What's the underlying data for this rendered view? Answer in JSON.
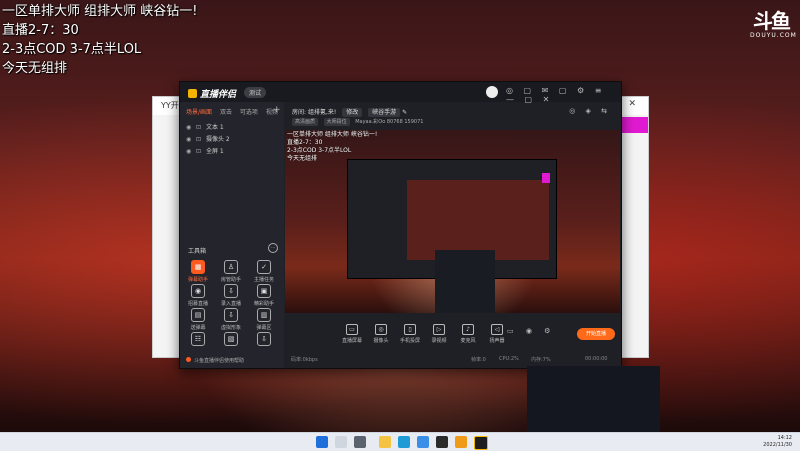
{
  "overlay_text": [
    "一区单排大师 组排大师 峡谷钻一!",
    "直播2-7：30",
    "2-3点COD 3-7点半LOL",
    "今天无组排"
  ],
  "douyu_logo": {
    "mark": "斗鱼",
    "sub": "DOUYU.COM"
  },
  "yy_window": {
    "title": "YY开"
  },
  "app": {
    "logo_text": "直播伴侣",
    "pill": "测试",
    "titlebar_icons": "◎ ▢ ✉ ▢ ⚙ ≡ — ▢ ✕",
    "tabs": [
      "场景/画面",
      "双击",
      "可选项",
      "视频"
    ],
    "scenes": [
      "文本 1",
      "摄像头 2",
      "全屏 1"
    ],
    "tools_title": "工具箱",
    "tools": [
      {
        "label": "弹幕助手",
        "icon": "▦",
        "active": true
      },
      {
        "label": "房管助手",
        "icon": "♙",
        "active": false
      },
      {
        "label": "主播任务",
        "icon": "✓",
        "active": false
      },
      {
        "label": "招募直播",
        "icon": "◉",
        "active": false
      },
      {
        "label": "录入直播",
        "icon": "⇩",
        "active": false
      },
      {
        "label": "精彩助手",
        "icon": "▣",
        "active": false
      },
      {
        "label": "送弹幕",
        "icon": "▤",
        "active": false
      },
      {
        "label": "虚拟形象",
        "icon": "⇩",
        "active": false
      },
      {
        "label": "弹幕区",
        "icon": "▥",
        "active": false
      },
      {
        "label": "",
        "icon": "☷",
        "active": false
      },
      {
        "label": "",
        "icon": "▧",
        "active": false
      },
      {
        "label": "",
        "icon": "⇩",
        "active": false
      }
    ],
    "bottom_link": "斗鱼直播伴侣使用帮助",
    "header": {
      "title": "房间:",
      "room_name": "组排氪,来!",
      "btn1": "修改",
      "btn2": "峡谷手游",
      "chip1": "高清画质",
      "chip2": "大师段位",
      "stat1": "Mayaa.彩Oo",
      "stat2": "80768",
      "stat3": "159071",
      "icons": "◎ ◈ ⇆"
    },
    "preview_text": [
      "一区单排大师 组排大师 峡谷钻一!",
      "直播2-7：30",
      "2-3点COD 3-7点半LOL",
      "今天无组排"
    ],
    "bottom_buttons": [
      {
        "label": "直播屏幕",
        "icon": "▭"
      },
      {
        "label": "摄像头",
        "icon": "◎"
      },
      {
        "label": "手机投屏",
        "icon": "▯"
      },
      {
        "label": "录视频",
        "icon": "▷"
      },
      {
        "label": "麦克风",
        "icon": "♪"
      },
      {
        "label": "扬声器",
        "icon": "◁"
      }
    ],
    "right_icons": "▭ ◉ ⚙",
    "go_live": "开始直播",
    "status": {
      "left": "码率:0kbps",
      "mid1": "帧率:0",
      "mid2": "CPU:2%",
      "mid3": "内存:7%",
      "time": "00:00:00"
    }
  },
  "taskbar": {
    "time": "14:12",
    "date": "2022/11/30"
  },
  "colors": {
    "accent": "#ff6a1a",
    "magenta": "#e01ad0"
  }
}
